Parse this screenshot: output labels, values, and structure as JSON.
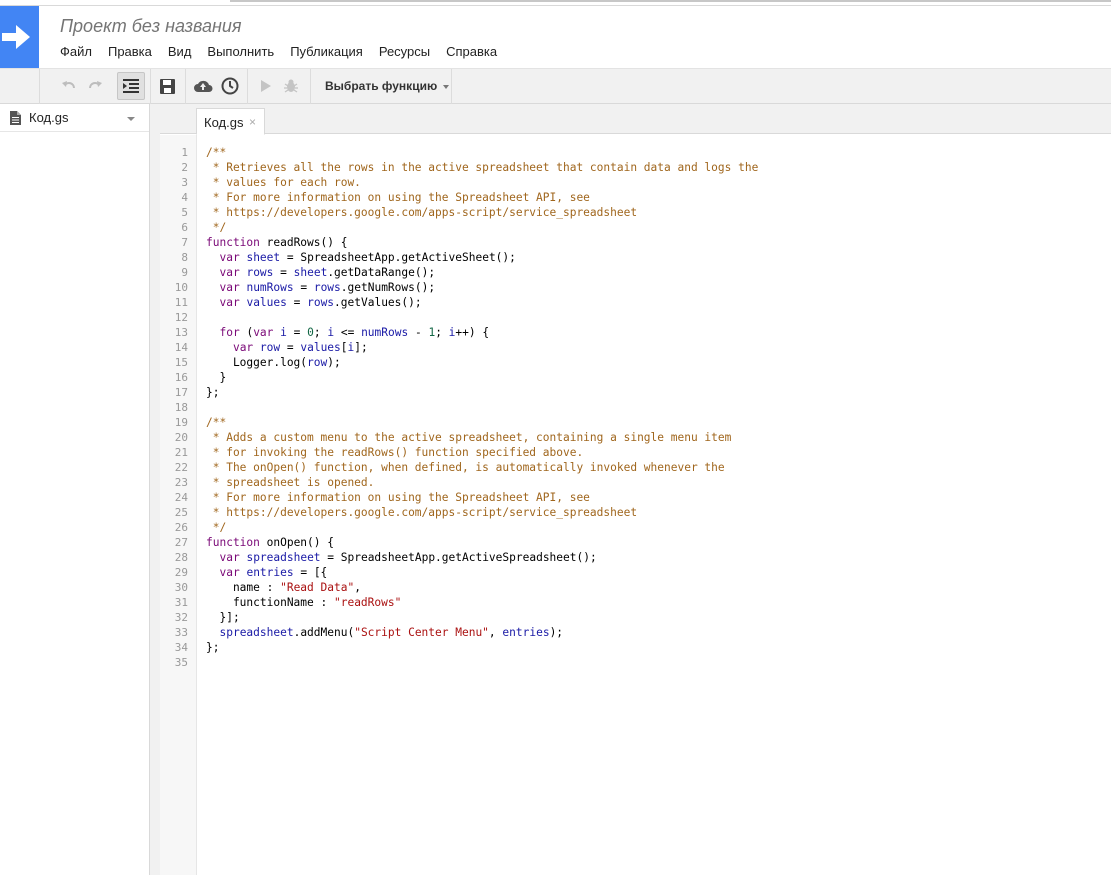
{
  "window": {
    "title": "Проект без названия",
    "colors": {
      "logo_bg": "#4285f4",
      "toolbar_bg": "#f1f1f1"
    }
  },
  "menu": {
    "items": [
      "Файл",
      "Правка",
      "Вид",
      "Выполнить",
      "Публикация",
      "Ресурсы",
      "Справка"
    ]
  },
  "toolbar": {
    "undo_icon": "undo-icon",
    "redo_icon": "redo-icon",
    "indent_icon": "indent-icon",
    "save_icon": "save-icon",
    "deploy_icon": "cloud-upload-icon",
    "triggers_icon": "clock-icon",
    "run_icon": "play-icon",
    "debug_icon": "bug-icon",
    "function_select_label": "Выбрать функцию"
  },
  "sidebar": {
    "files": [
      {
        "name": "Код.gs",
        "icon": "document-icon"
      }
    ]
  },
  "editor": {
    "tabs": [
      {
        "label": "Код.gs",
        "close": "×"
      }
    ],
    "line_numbers": [
      "1",
      "2",
      "3",
      "4",
      "5",
      "6",
      "7",
      "8",
      "9",
      "10",
      "11",
      "12",
      "13",
      "14",
      "15",
      "16",
      "17",
      "18",
      "19",
      "20",
      "21",
      "22",
      "23",
      "24",
      "25",
      "26",
      "27",
      "28",
      "29",
      "30",
      "31",
      "32",
      "33",
      "34",
      "35"
    ],
    "code_lines": [
      [
        [
          "com",
          "/**"
        ]
      ],
      [
        [
          "com",
          " * Retrieves all the rows in the active spreadsheet that contain data and logs the"
        ]
      ],
      [
        [
          "com",
          " * values for each row."
        ]
      ],
      [
        [
          "com",
          " * For more information on using the Spreadsheet API, see"
        ]
      ],
      [
        [
          "com",
          " * https://developers.google.com/apps-script/service_spreadsheet"
        ]
      ],
      [
        [
          "com",
          " */"
        ]
      ],
      [
        [
          "kw",
          "function"
        ],
        [
          "def",
          " readRows() {"
        ]
      ],
      [
        [
          "def",
          "  "
        ],
        [
          "kw",
          "var"
        ],
        [
          "def",
          " "
        ],
        [
          "var",
          "sheet"
        ],
        [
          "def",
          " = SpreadsheetApp.getActiveSheet();"
        ]
      ],
      [
        [
          "def",
          "  "
        ],
        [
          "kw",
          "var"
        ],
        [
          "def",
          " "
        ],
        [
          "var",
          "rows"
        ],
        [
          "def",
          " = "
        ],
        [
          "var",
          "sheet"
        ],
        [
          "def",
          ".getDataRange();"
        ]
      ],
      [
        [
          "def",
          "  "
        ],
        [
          "kw",
          "var"
        ],
        [
          "def",
          " "
        ],
        [
          "var",
          "numRows"
        ],
        [
          "def",
          " = "
        ],
        [
          "var",
          "rows"
        ],
        [
          "def",
          ".getNumRows();"
        ]
      ],
      [
        [
          "def",
          "  "
        ],
        [
          "kw",
          "var"
        ],
        [
          "def",
          " "
        ],
        [
          "var",
          "values"
        ],
        [
          "def",
          " = "
        ],
        [
          "var",
          "rows"
        ],
        [
          "def",
          ".getValues();"
        ]
      ],
      [
        [
          "def",
          ""
        ]
      ],
      [
        [
          "def",
          "  "
        ],
        [
          "kw",
          "for"
        ],
        [
          "def",
          " ("
        ],
        [
          "kw",
          "var"
        ],
        [
          "def",
          " "
        ],
        [
          "var",
          "i"
        ],
        [
          "def",
          " = "
        ],
        [
          "num",
          "0"
        ],
        [
          "def",
          "; "
        ],
        [
          "var",
          "i"
        ],
        [
          "def",
          " <= "
        ],
        [
          "var",
          "numRows"
        ],
        [
          "def",
          " - "
        ],
        [
          "num",
          "1"
        ],
        [
          "def",
          "; "
        ],
        [
          "var",
          "i"
        ],
        [
          "def",
          "++) {"
        ]
      ],
      [
        [
          "def",
          "    "
        ],
        [
          "kw",
          "var"
        ],
        [
          "def",
          " "
        ],
        [
          "var",
          "row"
        ],
        [
          "def",
          " = "
        ],
        [
          "var",
          "values"
        ],
        [
          "def",
          "["
        ],
        [
          "var",
          "i"
        ],
        [
          "def",
          "];"
        ]
      ],
      [
        [
          "def",
          "    Logger.log("
        ],
        [
          "var",
          "row"
        ],
        [
          "def",
          ");"
        ]
      ],
      [
        [
          "def",
          "  }"
        ]
      ],
      [
        [
          "def",
          "};"
        ]
      ],
      [
        [
          "def",
          ""
        ]
      ],
      [
        [
          "com",
          "/**"
        ]
      ],
      [
        [
          "com",
          " * Adds a custom menu to the active spreadsheet, containing a single menu item"
        ]
      ],
      [
        [
          "com",
          " * for invoking the readRows() function specified above."
        ]
      ],
      [
        [
          "com",
          " * The onOpen() function, when defined, is automatically invoked whenever the"
        ]
      ],
      [
        [
          "com",
          " * spreadsheet is opened."
        ]
      ],
      [
        [
          "com",
          " * For more information on using the Spreadsheet API, see"
        ]
      ],
      [
        [
          "com",
          " * https://developers.google.com/apps-script/service_spreadsheet"
        ]
      ],
      [
        [
          "com",
          " */"
        ]
      ],
      [
        [
          "kw",
          "function"
        ],
        [
          "def",
          " onOpen() {"
        ]
      ],
      [
        [
          "def",
          "  "
        ],
        [
          "kw",
          "var"
        ],
        [
          "def",
          " "
        ],
        [
          "var",
          "spreadsheet"
        ],
        [
          "def",
          " = SpreadsheetApp.getActiveSpreadsheet();"
        ]
      ],
      [
        [
          "def",
          "  "
        ],
        [
          "kw",
          "var"
        ],
        [
          "def",
          " "
        ],
        [
          "var",
          "entries"
        ],
        [
          "def",
          " = [{"
        ]
      ],
      [
        [
          "def",
          "    name : "
        ],
        [
          "str",
          "\"Read Data\""
        ],
        [
          "def",
          ","
        ]
      ],
      [
        [
          "def",
          "    functionName : "
        ],
        [
          "str",
          "\"readRows\""
        ]
      ],
      [
        [
          "def",
          "  }];"
        ]
      ],
      [
        [
          "def",
          "  "
        ],
        [
          "var",
          "spreadsheet"
        ],
        [
          "def",
          ".addMenu("
        ],
        [
          "str",
          "\"Script Center Menu\""
        ],
        [
          "def",
          ", "
        ],
        [
          "var",
          "entries"
        ],
        [
          "def",
          ");"
        ]
      ],
      [
        [
          "def",
          "};"
        ]
      ],
      [
        [
          "def",
          ""
        ]
      ]
    ]
  }
}
